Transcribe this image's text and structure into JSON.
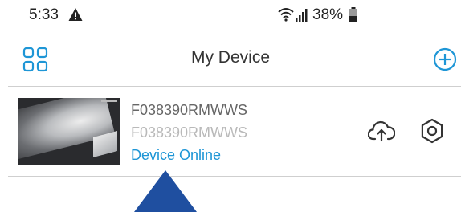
{
  "status_bar": {
    "time": "5:33",
    "battery_percent": "38%",
    "icons": [
      "warning-icon",
      "wifi-icon",
      "signal-icon",
      "battery-icon"
    ]
  },
  "header": {
    "title": "My Device",
    "left_icon": "grid-icon",
    "right_icon": "add-circle-icon"
  },
  "devices": [
    {
      "name": "F038390RMWWS",
      "id": "F038390RMWWS",
      "status": "Device Online",
      "actions": [
        "cloud-upload-icon",
        "gear-icon"
      ]
    }
  ],
  "colors": {
    "accent": "#1e96d6",
    "pointer": "#1f4fa0",
    "text_primary": "#333333",
    "text_secondary": "#666666",
    "text_muted": "#b9b9b9",
    "divider": "#cfcfcf"
  }
}
